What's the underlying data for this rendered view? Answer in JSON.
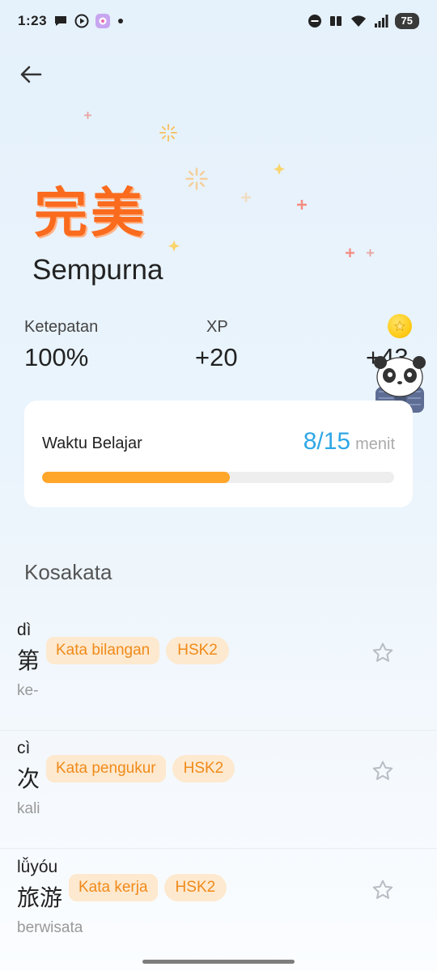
{
  "status_bar": {
    "time": "1:23",
    "battery": "75"
  },
  "result": {
    "hanzi_title": "完美",
    "subtitle": "Sempurna"
  },
  "stats": [
    {
      "label": "Ketepatan",
      "value": "100%"
    },
    {
      "label": "XP",
      "value": "+20"
    },
    {
      "label": "",
      "value": "+43"
    }
  ],
  "study_time": {
    "label": "Waktu Belajar",
    "progress": "8/15",
    "unit": "menit",
    "fraction": 0.533
  },
  "vocab_section": {
    "title": "Kosakata",
    "items": [
      {
        "pinyin": "dì",
        "hanzi": "第",
        "meaning": "ke-",
        "tag": "Kata bilangan",
        "level": "HSK2"
      },
      {
        "pinyin": "cì",
        "hanzi": "次",
        "meaning": "kali",
        "tag": "Kata pengukur",
        "level": "HSK2"
      },
      {
        "pinyin": "lǚyóu",
        "hanzi": "旅游",
        "meaning": "berwisata",
        "tag": "Kata kerja",
        "level": "HSK2"
      }
    ]
  },
  "colors": {
    "accent_orange": "#fa6b1e",
    "progress_fill": "#ffa62b",
    "progress_text": "#2fa7e6",
    "tag_bg": "#fde9cf",
    "tag_text": "#f08a1a"
  },
  "icons": {
    "back": "arrow-left-icon",
    "coin": "coin-icon",
    "star": "star-outline-icon",
    "mascot": "panda-mascot-icon"
  }
}
